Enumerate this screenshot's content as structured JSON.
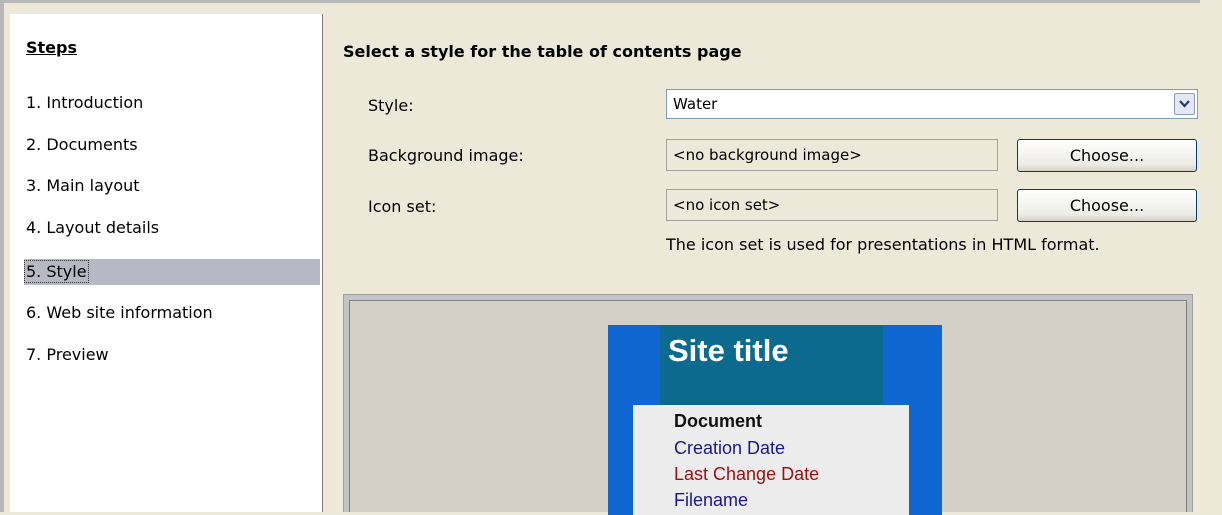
{
  "steps": {
    "title": "Steps",
    "items": [
      {
        "label": "1.  Introduction"
      },
      {
        "label": "2.  Documents"
      },
      {
        "label": "3.  Main layout"
      },
      {
        "label": "4.  Layout details"
      },
      {
        "label": "5.  Style",
        "selected": true
      },
      {
        "label": "6.  Web site information"
      },
      {
        "label": "7.  Preview"
      }
    ]
  },
  "main": {
    "heading": "Select a style for the table of contents page",
    "style": {
      "label": "Style:",
      "value": "Water"
    },
    "background_image": {
      "label": "Background image:",
      "value": "<no background image>",
      "button": "Choose..."
    },
    "icon_set": {
      "label": "Icon set:",
      "value": "<no icon set>",
      "button": "Choose..."
    },
    "hint": "The icon set is used for presentations in HTML format."
  },
  "preview": {
    "site_title": "Site title",
    "document": "Document",
    "creation_date": "Creation Date",
    "last_change_date": "Last Change Date",
    "filename": "Filename"
  },
  "colors": {
    "preview_blue": "#1066d0",
    "preview_title_bg": "#0d6a8f",
    "creation_date_text": "#1a1a80",
    "last_change_text": "#a01010",
    "selected_step_bg": "#b7b8c3"
  }
}
